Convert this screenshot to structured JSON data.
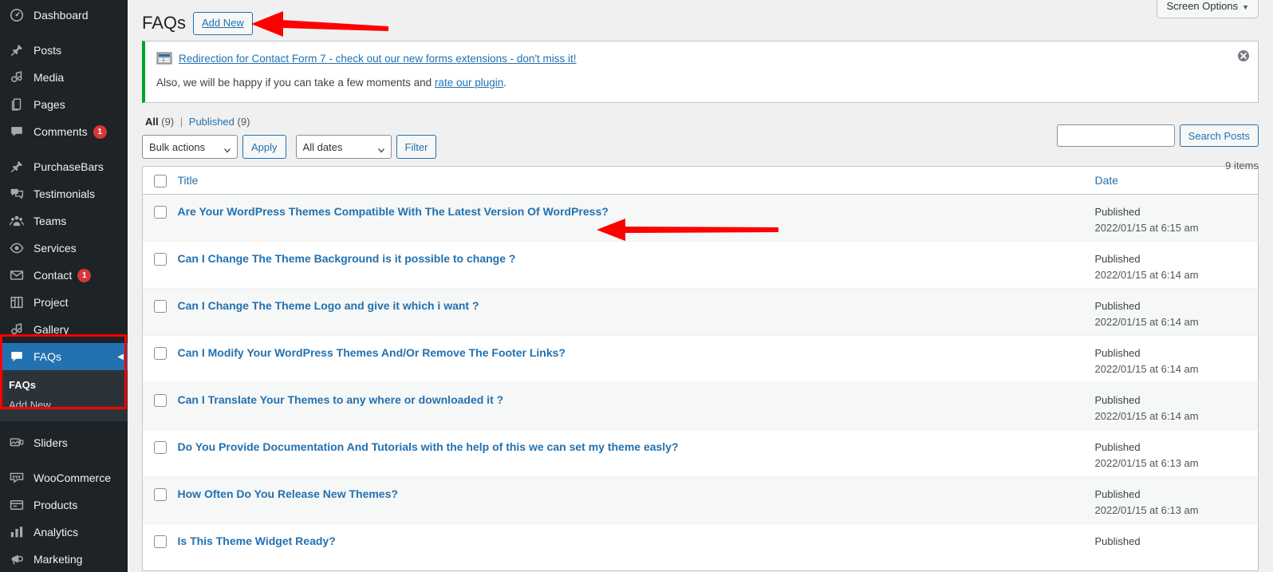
{
  "sidebar": {
    "items": [
      {
        "label": "Dashboard",
        "icon": "dashboard-icon",
        "badge": ""
      },
      {
        "label": "Posts",
        "icon": "pin-icon",
        "badge": ""
      },
      {
        "label": "Media",
        "icon": "media-icon",
        "badge": ""
      },
      {
        "label": "Pages",
        "icon": "pages-icon",
        "badge": ""
      },
      {
        "label": "Comments",
        "icon": "comment-icon",
        "badge": "1"
      },
      {
        "label": "PurchaseBars",
        "icon": "pin-icon",
        "badge": ""
      },
      {
        "label": "Testimonials",
        "icon": "testimonials-icon",
        "badge": ""
      },
      {
        "label": "Teams",
        "icon": "teams-icon",
        "badge": ""
      },
      {
        "label": "Services",
        "icon": "eye-icon",
        "badge": ""
      },
      {
        "label": "Contact",
        "icon": "envelope-icon",
        "badge": "1"
      },
      {
        "label": "Project",
        "icon": "project-icon",
        "badge": ""
      },
      {
        "label": "Gallery",
        "icon": "media-icon",
        "badge": ""
      }
    ],
    "current": {
      "label": "FAQs",
      "icon": "comment-icon"
    },
    "submenu": [
      {
        "label": "FAQs",
        "current": true
      },
      {
        "label": "Add New",
        "current": false
      }
    ],
    "items_after": [
      {
        "label": "Sliders",
        "icon": "sliders-icon",
        "badge": ""
      },
      {
        "label": "WooCommerce",
        "icon": "woocommerce-icon",
        "badge": ""
      },
      {
        "label": "Products",
        "icon": "products-icon",
        "badge": ""
      },
      {
        "label": "Analytics",
        "icon": "analytics-icon",
        "badge": ""
      },
      {
        "label": "Marketing",
        "icon": "marketing-icon",
        "badge": ""
      }
    ]
  },
  "screen_options": {
    "label": "Screen Options",
    "caret": "▼"
  },
  "header": {
    "title": "FAQs",
    "add_new_label": "Add New"
  },
  "notice": {
    "link_text": "Redirection for Contact Form 7 - check out our new forms extensions - don't miss it!",
    "body_prefix": "Also, we will be happy if you can take a few moments and ",
    "body_link": "rate our plugin",
    "body_suffix": ".",
    "accent_color": "#00a32b"
  },
  "filters": {
    "all_label": "All",
    "all_count": "(9)",
    "separator": "|",
    "published_label": "Published",
    "published_count": "(9)",
    "bulk_actions_value": "Bulk actions",
    "apply_label": "Apply",
    "all_dates_value": "All dates",
    "filter_label": "Filter"
  },
  "search": {
    "value": "",
    "placeholder": "",
    "button_label": "Search Posts"
  },
  "displaying_num": "9 items",
  "table": {
    "columns": {
      "title": "Title",
      "date": "Date"
    },
    "rows": [
      {
        "title": "Are Your WordPress Themes Compatible With The Latest Version Of WordPress?",
        "status": "Published",
        "date": "2022/01/15 at 6:15 am"
      },
      {
        "title": "Can I Change The Theme Background is it possible to change ?",
        "status": "Published",
        "date": "2022/01/15 at 6:14 am"
      },
      {
        "title": "Can I Change The Theme Logo and give it which i want ?",
        "status": "Published",
        "date": "2022/01/15 at 6:14 am"
      },
      {
        "title": "Can I Modify Your WordPress Themes And/Or Remove The Footer Links?",
        "status": "Published",
        "date": "2022/01/15 at 6:14 am"
      },
      {
        "title": "Can I Translate Your Themes to any where or downloaded it ?",
        "status": "Published",
        "date": "2022/01/15 at 6:14 am"
      },
      {
        "title": "Do You Provide Documentation And Tutorials with the help of this we can set my theme easly?",
        "status": "Published",
        "date": "2022/01/15 at 6:13 am"
      },
      {
        "title": "How Often Do You Release New Themes?",
        "status": "Published",
        "date": "2022/01/15 at 6:13 am"
      },
      {
        "title": "Is This Theme Widget Ready?",
        "status": "Published",
        "date": ""
      }
    ]
  },
  "annotations": {
    "color": "#ff0000",
    "arrows": [
      "points-to-add-new-button",
      "points-to-first-row-title"
    ],
    "rectangles": [
      "highlights-faqs-menu-section"
    ]
  }
}
